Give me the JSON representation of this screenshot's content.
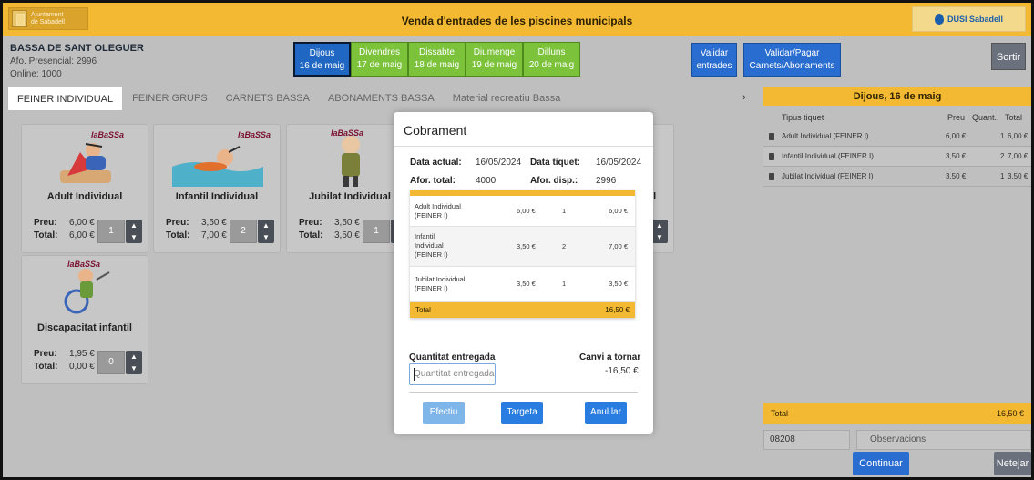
{
  "header": {
    "logo_left_line1": "Ajuntament",
    "logo_left_line2": "de Sabadell",
    "title": "Venda d'entrades de les piscines municipals",
    "logo_right": "DUSI Sabadell"
  },
  "venue": {
    "name": "BASSA DE SANT OLEGUER",
    "presencial": "Afo. Presencial: 2996",
    "online": "Online: 1000"
  },
  "days": [
    {
      "name": "Dijous",
      "date": "16 de maig",
      "active": true
    },
    {
      "name": "Divendres",
      "date": "17 de maig",
      "active": false
    },
    {
      "name": "Dissabte",
      "date": "18 de maig",
      "active": false
    },
    {
      "name": "Diumenge",
      "date": "19 de maig",
      "active": false
    },
    {
      "name": "Dilluns",
      "date": "20 de maig",
      "active": false
    }
  ],
  "actions": {
    "validar_line1": "Validar",
    "validar_line2": "entrades",
    "pagar_line1": "Validar/Pagar",
    "pagar_line2": "Carnets/Abonaments",
    "sortir": "Sortir"
  },
  "tabs": [
    "FEINER INDIVIDUAL",
    "FEINER GRUPS",
    "CARNETS BASSA",
    "ABONAMENTS BASSA",
    "Material recreatiu Bassa"
  ],
  "tabs_chevron": "›",
  "products": [
    {
      "name": "Adult Individual",
      "preu": "6,00 €",
      "total": "6,00 €",
      "qty": "1"
    },
    {
      "name": "Infantil Individual",
      "preu": "3,50 €",
      "total": "7,00 €",
      "qty": "2"
    },
    {
      "name": "Jubilat Individual",
      "preu": "3,50 €",
      "total": "3,50 €",
      "qty": "1"
    },
    {
      "name": "Discapacitat infantil",
      "preu": "1,95 €",
      "total": "0,00 €",
      "qty": "0"
    }
  ],
  "product_labels": {
    "preu": "Preu:",
    "total": "Total:"
  },
  "brand_mini": "laBaSSa",
  "partial_card_suffix": "al",
  "right_panel": {
    "title": "Dijous, 16 de maig",
    "col_tipus": "Tipus tiquet",
    "col_preu": "Preu",
    "col_quant": "Quant.",
    "col_total": "Total",
    "rows": [
      {
        "name": "Adult Individual (FEINER I)",
        "preu": "6,00 €",
        "quant": "1",
        "total": "6,00 €"
      },
      {
        "name": "Infantil Individual (FEINER I)",
        "preu": "3,50 €",
        "quant": "2",
        "total": "7,00 €"
      },
      {
        "name": "Jubilat Individual (FEINER I)",
        "preu": "3,50 €",
        "quant": "1",
        "total": "3,50 €"
      }
    ],
    "total_label": "Total",
    "total_value": "16,50 €",
    "cp_value": "08208",
    "obs_placeholder": "Observacions",
    "continuar": "Continuar",
    "netejar": "Netejar"
  },
  "modal": {
    "title": "Cobrament",
    "data_actual_label": "Data actual:",
    "data_actual": "16/05/2024",
    "data_tiquet_label": "Data tiquet:",
    "data_tiquet": "16/05/2024",
    "afor_total_label": "Afor. total:",
    "afor_total": "4000",
    "afor_disp_label": "Afor. disp.:",
    "afor_disp": "2996",
    "rows": [
      {
        "name_l1": "Adult Individual",
        "name_l2": "(FEINER I)",
        "name_l3": "",
        "preu": "6,00 €",
        "quant": "1",
        "total": "6,00 €"
      },
      {
        "name_l1": "Infantil",
        "name_l2": "Individual",
        "name_l3": "(FEINER I)",
        "preu": "3,50 €",
        "quant": "2",
        "total": "7,00 €"
      },
      {
        "name_l1": "Jubilat Individual",
        "name_l2": "(FEINER I)",
        "name_l3": "",
        "preu": "3,50 €",
        "quant": "1",
        "total": "3,50 €"
      }
    ],
    "total_label": "Total",
    "total_value": "16,50 €",
    "quantitat_label": "Quantitat entregada",
    "quantitat_placeholder": "Quantitat entregada",
    "canvi_label": "Canvi a tornar",
    "canvi_value": "-16,50 €",
    "btn_efectiu": "Efectiu",
    "btn_targeta": "Targeta",
    "btn_anular": "Anul.lar"
  },
  "colors": {
    "header_yellow": "#f4b932",
    "day_green": "#7cc23b",
    "primary_blue": "#2a6dd0",
    "grey_button": "#6b717c"
  }
}
